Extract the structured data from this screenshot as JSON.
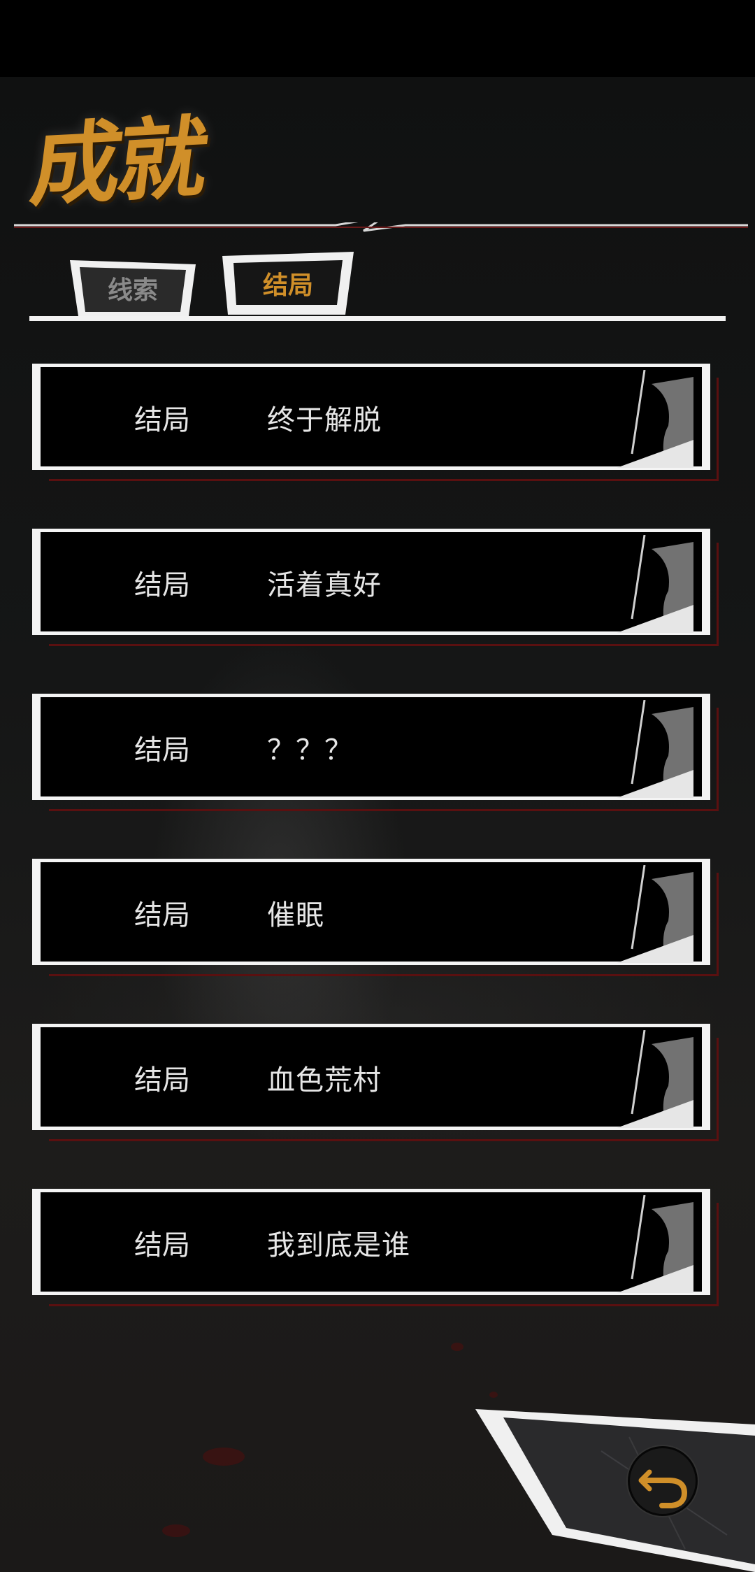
{
  "title": "成就",
  "tabs": [
    {
      "label": "线索",
      "active": false
    },
    {
      "label": "结局",
      "active": true
    }
  ],
  "endings": [
    {
      "label": "结局",
      "name": "终于解脱"
    },
    {
      "label": "结局",
      "name": "活着真好"
    },
    {
      "label": "结局",
      "name": "？？？"
    },
    {
      "label": "结局",
      "name": "催眠"
    },
    {
      "label": "结局",
      "name": "血色荒村"
    },
    {
      "label": "结局",
      "name": "我到底是谁"
    }
  ],
  "back_button": {
    "icon": "back-arrow-icon"
  },
  "colors": {
    "accent": "#d08f29",
    "frame": "#f4f4f4",
    "blood": "#5a1010",
    "background": "#0c0c0c"
  }
}
